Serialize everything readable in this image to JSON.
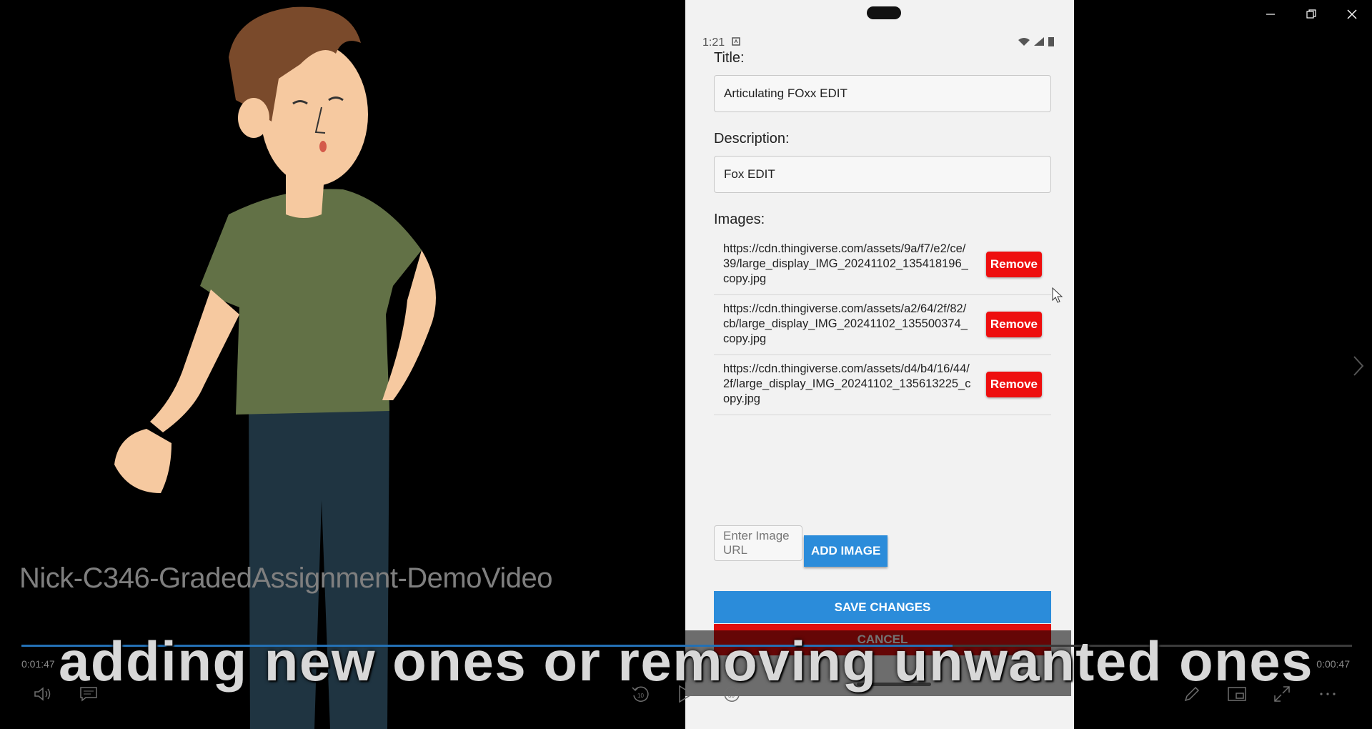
{
  "window": {
    "controls": [
      "minimize-icon",
      "restore-icon",
      "close-icon"
    ]
  },
  "video": {
    "title": "Nick-C346-GradedAssignment-DemoVideo",
    "subtitle": "adding new ones or removing unwanted ones",
    "time_elapsed": "0:01:47",
    "time_remaining": "0:00:47",
    "progress_fraction": 0.7
  },
  "phone": {
    "status_time": "1:21",
    "title_label": "Title:",
    "title_value": "Articulating FOxx EDIT",
    "description_label": "Description:",
    "description_value": "Fox EDIT",
    "images_label": "Images:",
    "images": [
      {
        "url": "https://cdn.thingiverse.com/assets/9a/f7/e2/ce/39/large_display_IMG_20241102_135418196_copy.jpg",
        "remove_label": "Remove"
      },
      {
        "url": "https://cdn.thingiverse.com/assets/a2/64/2f/82/cb/large_display_IMG_20241102_135500374_copy.jpg",
        "remove_label": "Remove"
      },
      {
        "url": "https://cdn.thingiverse.com/assets/d4/b4/16/44/2f/large_display_IMG_20241102_135613225_copy.jpg",
        "remove_label": "Remove"
      }
    ],
    "image_url_placeholder": "Enter Image URL",
    "add_image_label": "ADD IMAGE",
    "save_label": "SAVE CHANGES",
    "cancel_label": "CANCEL"
  },
  "colors": {
    "accent_blue": "#2b8cda",
    "danger_red": "#ee0e0e",
    "progress": "#2471b5"
  }
}
